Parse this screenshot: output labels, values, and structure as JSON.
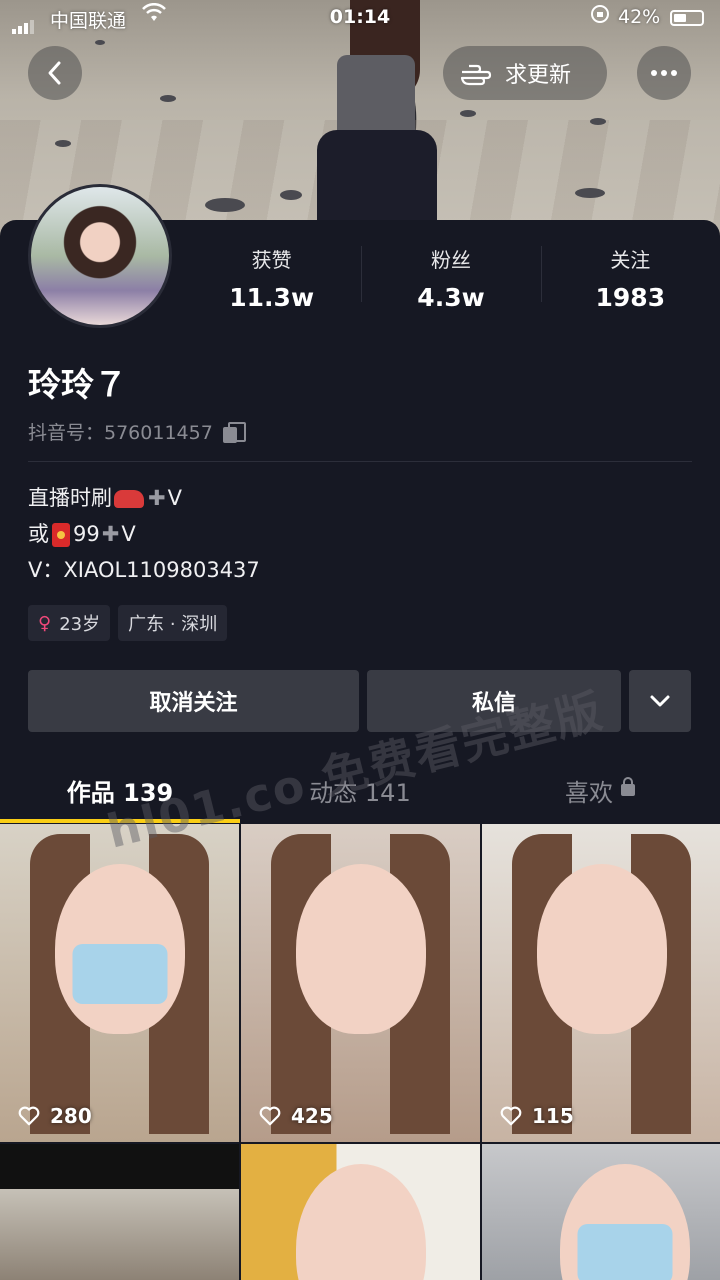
{
  "status_bar": {
    "carrier": "中国联通",
    "time": "01:14",
    "battery": "42%"
  },
  "top_actions": {
    "update_label": "求更新"
  },
  "profile": {
    "name": "玲玲７",
    "douyin_id": "抖音号：576011457",
    "stats": [
      {
        "label": "获赞",
        "value": "11.3w"
      },
      {
        "label": "粉丝",
        "value": "4.3w"
      },
      {
        "label": "关注",
        "value": "1983"
      }
    ],
    "bio": {
      "line1_text": "直播时刷",
      "line1_suffix": "V",
      "line2_prefix": "或",
      "line2_amount": "99",
      "line2_suffix": "V",
      "line3": "V：XIAOL1109803437"
    },
    "tags": {
      "age": "23岁",
      "location": "广东 · 深圳"
    }
  },
  "buttons": {
    "unfollow": "取消关注",
    "message": "私信"
  },
  "tabs": [
    {
      "label": "作品 139"
    },
    {
      "label": "动态 141"
    },
    {
      "label": "喜欢"
    }
  ],
  "watermark": "hl01.co 免费看完整版",
  "videos": [
    {
      "likes": "280"
    },
    {
      "likes": "425"
    },
    {
      "likes": "115"
    }
  ],
  "icons": {
    "back": "chevron-left-icon",
    "hand": "pointing-hand-icon",
    "more": "more-dots-icon",
    "copy": "copy-icon",
    "dropdown": "chevron-down-icon",
    "heart": "heart-icon",
    "lock": "lock-icon"
  },
  "colors": {
    "background": "#161823",
    "accent": "#face15",
    "button": "#393b44",
    "female": "#f0487a"
  }
}
